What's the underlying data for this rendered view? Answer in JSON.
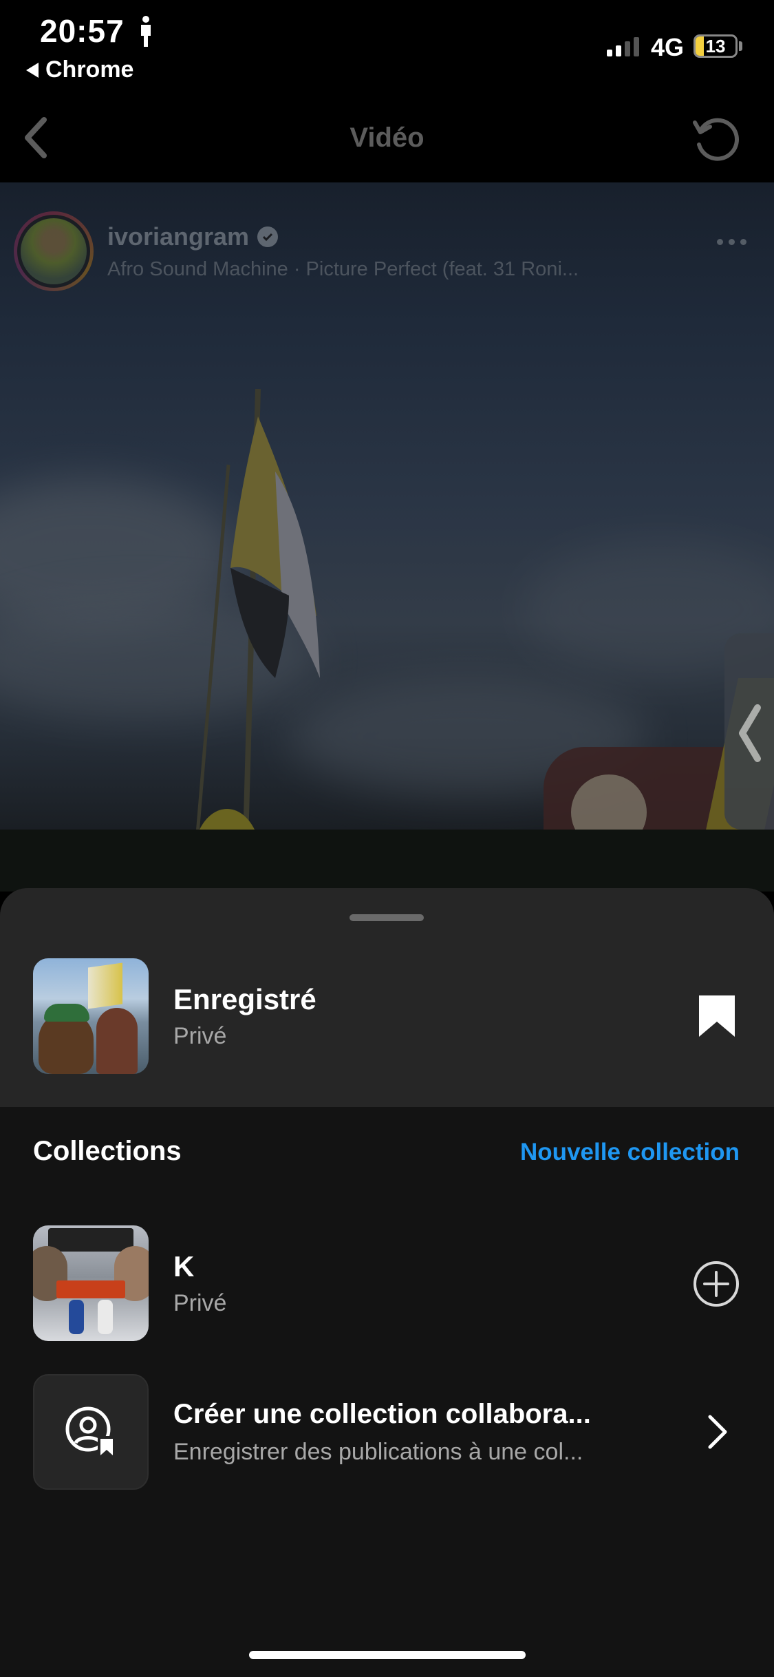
{
  "status_bar": {
    "time": "20:57",
    "back_app": "Chrome",
    "network": "4G",
    "battery": "13"
  },
  "nav": {
    "title": "Vidéo"
  },
  "post": {
    "username": "ivoriangram",
    "music": "Afro Sound Machine · Picture Perfect (feat. 31 Roni..."
  },
  "sheet": {
    "saved_title": "Enregistré",
    "saved_subtitle": "Privé",
    "collections_heading": "Collections",
    "new_collection_link": "Nouvelle collection",
    "collections": [
      {
        "title": "K",
        "subtitle": "Privé"
      }
    ],
    "collab": {
      "title": "Créer une collection collabora...",
      "subtitle": "Enregistrer des publications à une col..."
    }
  },
  "colors": {
    "accent": "#1f97f2",
    "sheet_bg": "#131313",
    "saved_bg": "#262626"
  }
}
